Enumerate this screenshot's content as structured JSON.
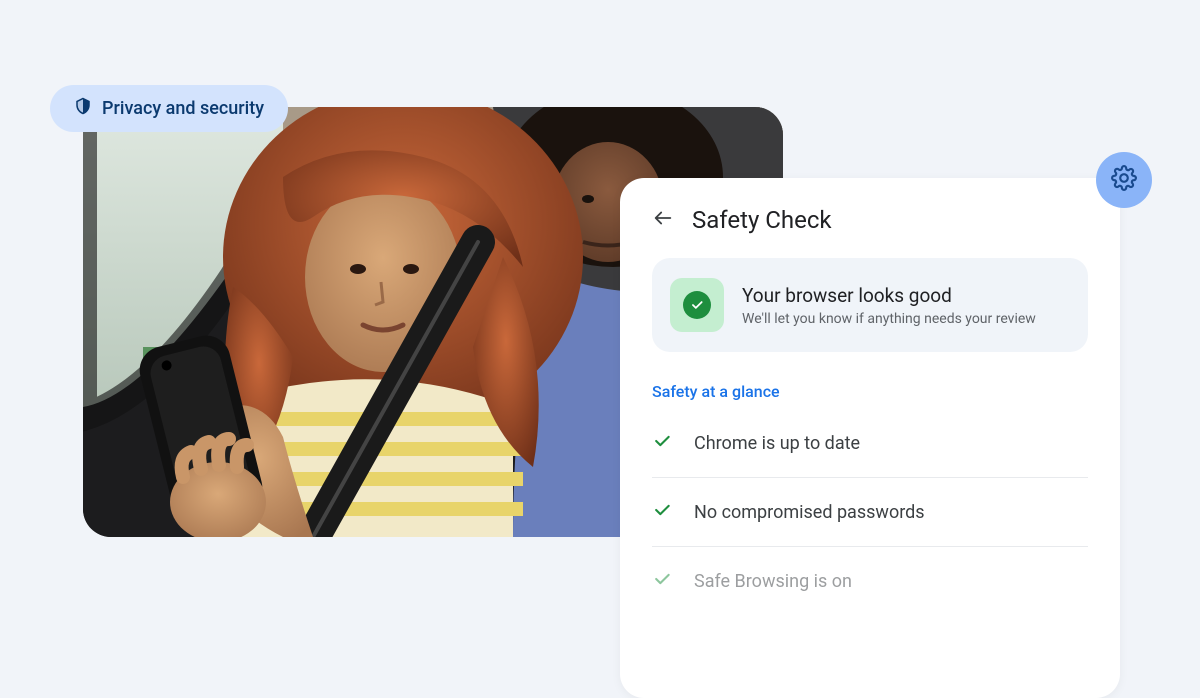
{
  "chip": {
    "label": "Privacy and security"
  },
  "gear": {
    "name": "settings"
  },
  "card": {
    "title": "Safety Check",
    "status": {
      "title": "Your browser looks good",
      "subtitle": "We'll let you know if anything needs your review"
    },
    "section_label": "Safety at a glance",
    "items": [
      {
        "label": "Chrome is up to date"
      },
      {
        "label": "No compromised passwords"
      },
      {
        "label": "Safe Browsing is on"
      }
    ]
  },
  "colors": {
    "chip_bg": "#d3e3fd",
    "chip_fg": "#0b3a6f",
    "accent": "#1a73e8",
    "success": "#1e8e3e",
    "success_bg": "#c4eed0",
    "gear_bg": "#8ab4f8"
  }
}
